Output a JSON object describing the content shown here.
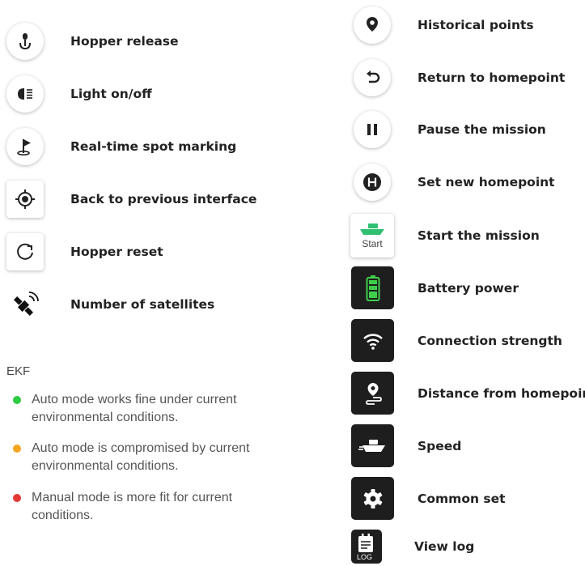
{
  "left_items": [
    {
      "icon": "hopper-release-icon",
      "label": "Hopper release"
    },
    {
      "icon": "light-icon",
      "label": "Light on/off"
    },
    {
      "icon": "flag-icon",
      "label": "Real-time spot marking"
    },
    {
      "icon": "target-icon",
      "label": "Back to previous interface"
    },
    {
      "icon": "reset-icon",
      "label": "Hopper reset"
    },
    {
      "icon": "satellite-icon",
      "label": "Number of satellites"
    }
  ],
  "ekf": {
    "title": "EKF",
    "items": [
      {
        "color": "#2ecc40",
        "text": "Auto mode works fine under current environmental conditions."
      },
      {
        "color": "#f5a623",
        "text": "Auto mode is compromised by current environmental conditions."
      },
      {
        "color": "#e53935",
        "text": "Manual mode is more fit for current conditions."
      }
    ]
  },
  "right_items": [
    {
      "icon": "location-pin-icon",
      "label": "Historical points"
    },
    {
      "icon": "return-arrow-icon",
      "label": "Return to homepoint"
    },
    {
      "icon": "pause-icon",
      "label": "Pause the mission"
    },
    {
      "icon": "home-h-icon",
      "label": "Set new homepoint"
    },
    {
      "icon": "boat-start-icon",
      "label": "Start the mission",
      "badge": "Start"
    },
    {
      "icon": "battery-icon",
      "label": "Battery power"
    },
    {
      "icon": "wifi-icon",
      "label": "Connection strength"
    },
    {
      "icon": "distance-pin-icon",
      "label": "Distance from homepoint"
    },
    {
      "icon": "speed-boat-icon",
      "label": "Speed"
    },
    {
      "icon": "gear-icon",
      "label": "Common set"
    },
    {
      "icon": "log-icon",
      "label": "View log",
      "badge": "LOG"
    }
  ],
  "colors": {
    "battery_green": "#3ecf4a",
    "boat_green": "#2fbf71",
    "dark_tile": "#1e1e1e"
  }
}
